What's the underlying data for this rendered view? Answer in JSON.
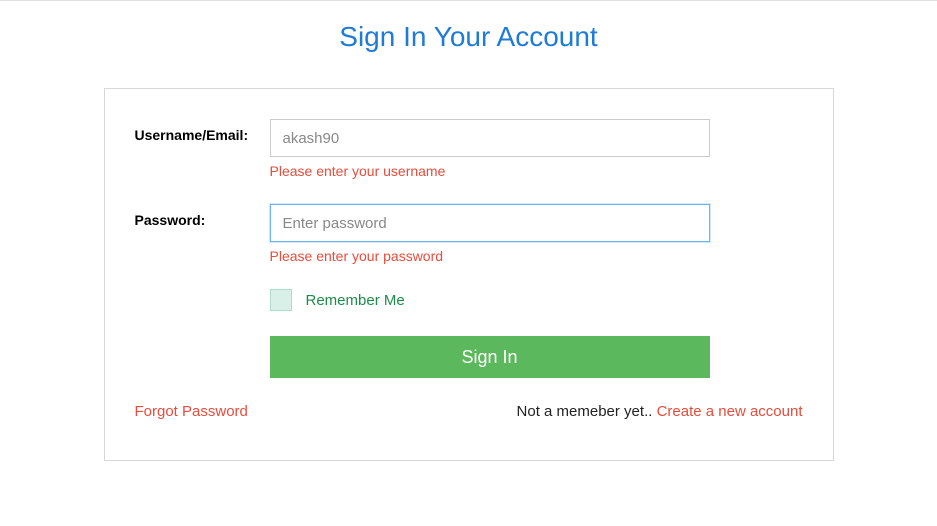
{
  "page": {
    "title": "Sign In Your Account"
  },
  "form": {
    "username": {
      "label": "Username/Email:",
      "placeholder": "akash90",
      "value": "",
      "error": "Please enter your username"
    },
    "password": {
      "label": "Password:",
      "placeholder": "Enter password",
      "value": "",
      "error": "Please enter your password"
    },
    "remember": {
      "label": "Remember Me",
      "checked": false
    },
    "submit": {
      "label": "Sign In"
    }
  },
  "links": {
    "forgot": "Forgot Password",
    "member_text": "Not a memeber yet.. ",
    "create": "Create a new account"
  }
}
